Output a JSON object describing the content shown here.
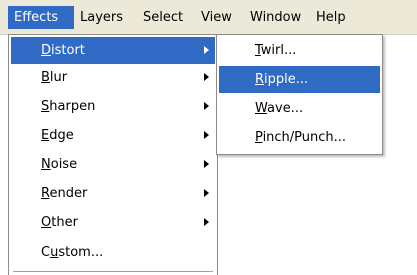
{
  "menubar": {
    "items": [
      {
        "label": "Effects",
        "mnemonic": "E",
        "active": true
      },
      {
        "label": "Layers",
        "mnemonic": "L",
        "active": false
      },
      {
        "label": "Select",
        "mnemonic": "S",
        "active": false
      },
      {
        "label": "View",
        "mnemonic": "V",
        "active": false
      },
      {
        "label": "Window",
        "mnemonic": "W",
        "active": false
      },
      {
        "label": "Help",
        "mnemonic": "H",
        "active": false
      }
    ]
  },
  "effects_menu": {
    "items": [
      {
        "label": "Distort",
        "mnemonic": "D",
        "submenu": true,
        "active": true
      },
      {
        "label": "Blur",
        "mnemonic": "B",
        "submenu": true,
        "active": false
      },
      {
        "label": "Sharpen",
        "mnemonic": "S",
        "submenu": true,
        "active": false
      },
      {
        "label": "Edge",
        "mnemonic": "E",
        "submenu": true,
        "active": false
      },
      {
        "label": "Noise",
        "mnemonic": "N",
        "submenu": true,
        "active": false
      },
      {
        "label": "Render",
        "mnemonic": "R",
        "submenu": true,
        "active": false
      },
      {
        "label": "Other",
        "mnemonic": "O",
        "submenu": true,
        "active": false
      },
      {
        "label": "Custom...",
        "mnemonic": "u",
        "submenu": false,
        "active": false
      }
    ]
  },
  "distort_submenu": {
    "items": [
      {
        "label": "Twirl...",
        "mnemonic": "T",
        "active": false
      },
      {
        "label": "Ripple...",
        "mnemonic": "R",
        "active": true
      },
      {
        "label": "Wave...",
        "mnemonic": "W",
        "active": false
      },
      {
        "label": "Pinch/Punch...",
        "mnemonic": "P",
        "active": false
      }
    ]
  },
  "colors": {
    "menubar_bg": "#ece9d8",
    "highlight": "#316ac5",
    "menu_bg": "#ffffff"
  }
}
